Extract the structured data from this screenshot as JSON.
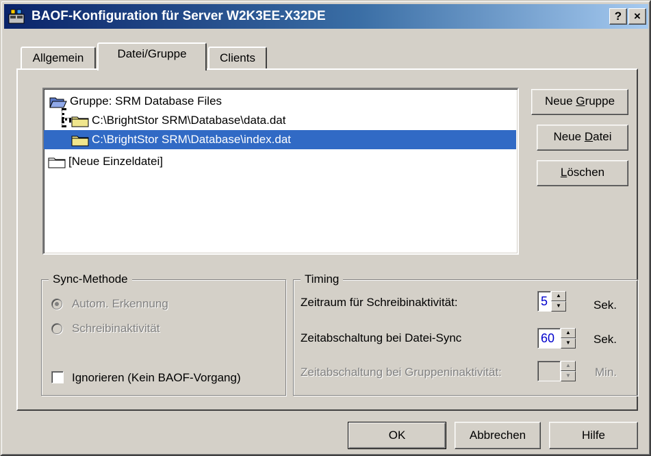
{
  "window": {
    "title": "BAOF-Konfiguration für Server W2K3EE-X32DE",
    "help_btn": "?",
    "close_btn": "×"
  },
  "tabs": [
    {
      "label": "Allgemein",
      "active": false
    },
    {
      "label": "Datei/Gruppe",
      "active": true
    },
    {
      "label": "Clients",
      "active": false
    }
  ],
  "tree": {
    "items": [
      {
        "label": "Gruppe: SRM Database Files",
        "icon": "open-folder-icon",
        "selected": false
      },
      {
        "label": "C:\\BrightStor SRM\\Database\\data.dat",
        "icon": "folder-icon",
        "selected": false
      },
      {
        "label": "C:\\BrightStor SRM\\Database\\index.dat",
        "icon": "folder-icon",
        "selected": true
      },
      {
        "label": "[Neue Einzeldatei]",
        "icon": "empty-folder-icon",
        "selected": false
      }
    ]
  },
  "side_buttons": {
    "new_group_pre": "Neue ",
    "new_group_key": "G",
    "new_group_post": "ruppe",
    "new_file_pre": "Neue ",
    "new_file_key": "D",
    "new_file_post": "atei",
    "delete_key": "L",
    "delete_post": "öschen"
  },
  "sync": {
    "title": "Sync-Methode",
    "option_auto": "Autom. Erkennung",
    "option_write": "Schreibinaktivität",
    "ignore_label": "Ignorieren (Kein BAOF-Vorgang)"
  },
  "timing": {
    "title": "Timing",
    "write_label": "Zeitraum für Schreibinaktivität:",
    "write_value": "5",
    "write_unit": "Sek.",
    "sync_label": "Zeitabschaltung bei Datei-Sync",
    "sync_value": "60",
    "sync_unit": "Sek.",
    "group_label": "Zeitabschaltung bei Gruppeninaktivität:",
    "group_value": "",
    "group_unit": "Min."
  },
  "footer": {
    "ok": "OK",
    "cancel": "Abbrechen",
    "help": "Hilfe"
  },
  "colors": {
    "title_gradient_start": "#0a246a",
    "selection": "#316ac5",
    "folder_yellow": "#f0e68c"
  }
}
